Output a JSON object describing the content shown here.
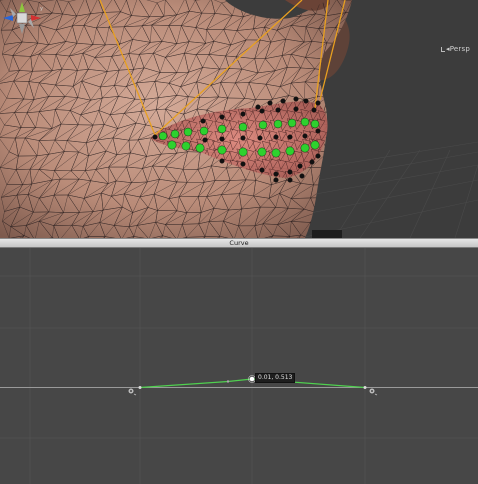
{
  "scene": {
    "projection_label": "◂Persp",
    "gizmo_icon": "axis-gizmo-icon",
    "colors": {
      "background": "#3c3c3c",
      "skin": "#c09584",
      "wireframe": "#2a2020",
      "handle_lines": "#e8a020",
      "control_dots_green": "#2ed12e",
      "control_dots_black": "#111111",
      "lip_tint": "#c8645c"
    }
  },
  "curve_panel": {
    "title": "Curve",
    "selected_key_label": "0.01, 0.513",
    "colors": {
      "background": "#474747",
      "grid": "#505050",
      "baseline": "#9a9a9a",
      "curve": "#4fd14f"
    }
  }
}
